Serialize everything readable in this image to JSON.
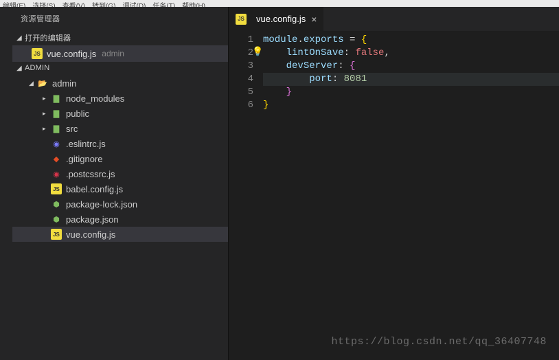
{
  "menubar": [
    "编辑(E)",
    "选择(S)",
    "查看(V)",
    "转到(G)",
    "调试(D)",
    "任务(T)",
    "帮助(H)"
  ],
  "sidebar": {
    "title": "资源管理器",
    "openEditors": {
      "header": "打开的编辑器",
      "items": [
        {
          "name": "vue.config.js",
          "path": "admin"
        }
      ]
    },
    "workspace": {
      "header": "ADMIN",
      "tree": [
        {
          "type": "folder",
          "name": "admin",
          "depth": 1,
          "open": true,
          "iconClass": "ic-folder",
          "iconGlyph": "📂"
        },
        {
          "type": "folder",
          "name": "node_modules",
          "depth": 2,
          "open": false,
          "iconClass": "ic-folder-green",
          "iconGlyph": "▇"
        },
        {
          "type": "folder",
          "name": "public",
          "depth": 2,
          "open": false,
          "iconClass": "ic-folder-green",
          "iconGlyph": "▇"
        },
        {
          "type": "folder",
          "name": "src",
          "depth": 2,
          "open": false,
          "iconClass": "ic-folder-green",
          "iconGlyph": "▇"
        },
        {
          "type": "file",
          "name": ".eslintrc.js",
          "depth": 2,
          "iconClass": "ic-eslint",
          "iconGlyph": "◉"
        },
        {
          "type": "file",
          "name": ".gitignore",
          "depth": 2,
          "iconClass": "ic-git",
          "iconGlyph": "◆"
        },
        {
          "type": "file",
          "name": ".postcssrc.js",
          "depth": 2,
          "iconClass": "ic-postcss",
          "iconGlyph": "◉"
        },
        {
          "type": "file",
          "name": "babel.config.js",
          "depth": 2,
          "iconClass": "ic-js",
          "iconGlyph": "JS"
        },
        {
          "type": "file",
          "name": "package-lock.json",
          "depth": 2,
          "iconClass": "ic-json",
          "iconGlyph": "⬢"
        },
        {
          "type": "file",
          "name": "package.json",
          "depth": 2,
          "iconClass": "ic-json",
          "iconGlyph": "⬢"
        },
        {
          "type": "file",
          "name": "vue.config.js",
          "depth": 2,
          "iconClass": "ic-js",
          "iconGlyph": "JS",
          "selected": true
        }
      ]
    }
  },
  "editor": {
    "tab": {
      "name": "vue.config.js"
    },
    "lines": [
      "1",
      "2",
      "3",
      "4",
      "5",
      "6"
    ],
    "code": {
      "l1": {
        "a": "module",
        "b": ".",
        "c": "exports",
        "d": " = ",
        "e": "{"
      },
      "l2": {
        "a": "lintOnSave",
        "b": ": ",
        "c": "false",
        "d": ","
      },
      "l3": {
        "a": "devServer",
        "b": ": ",
        "c": "{"
      },
      "l4": {
        "a": "port",
        "b": ": ",
        "c": "8081"
      },
      "l5": {
        "a": "}"
      },
      "l6": {
        "a": "}"
      }
    }
  },
  "watermark": "https://blog.csdn.net/qq_36407748"
}
